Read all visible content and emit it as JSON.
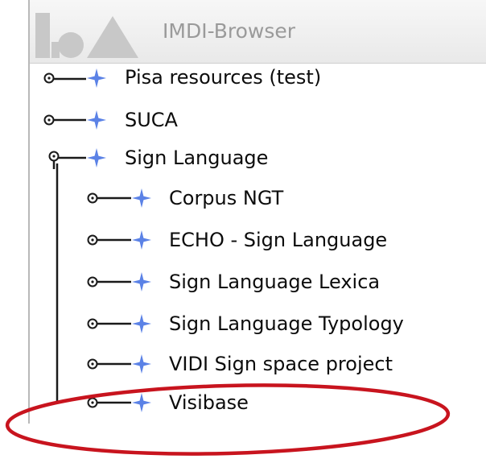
{
  "app": {
    "title": "IMDI-Browser"
  },
  "tree": {
    "nodes": [
      {
        "label": "Pisa resources (test)",
        "level": 0,
        "expanded": false
      },
      {
        "label": "SUCA",
        "level": 0,
        "expanded": false
      },
      {
        "label": "Sign Language",
        "level": 0,
        "expanded": true
      },
      {
        "label": "Corpus NGT",
        "level": 1,
        "expanded": false
      },
      {
        "label": "ECHO - Sign Language",
        "level": 1,
        "expanded": false
      },
      {
        "label": "Sign Language Lexica",
        "level": 1,
        "expanded": false
      },
      {
        "label": "Sign Language Typology",
        "level": 1,
        "expanded": false
      },
      {
        "label": "VIDI Sign space project",
        "level": 1,
        "expanded": false
      },
      {
        "label": "Visibase",
        "level": 1,
        "expanded": false
      }
    ]
  },
  "colors": {
    "node_icon": "#5b82e6",
    "highlight_ellipse": "#c8141e",
    "title_text": "#9a9a9a"
  },
  "icons": {
    "node": "blue-four-point-star-icon",
    "toggle_collapsed": "collapsed-node-handle-icon",
    "toggle_expanded": "expanded-node-handle-icon"
  },
  "annotation": {
    "highlighted_node": "Visibase"
  }
}
